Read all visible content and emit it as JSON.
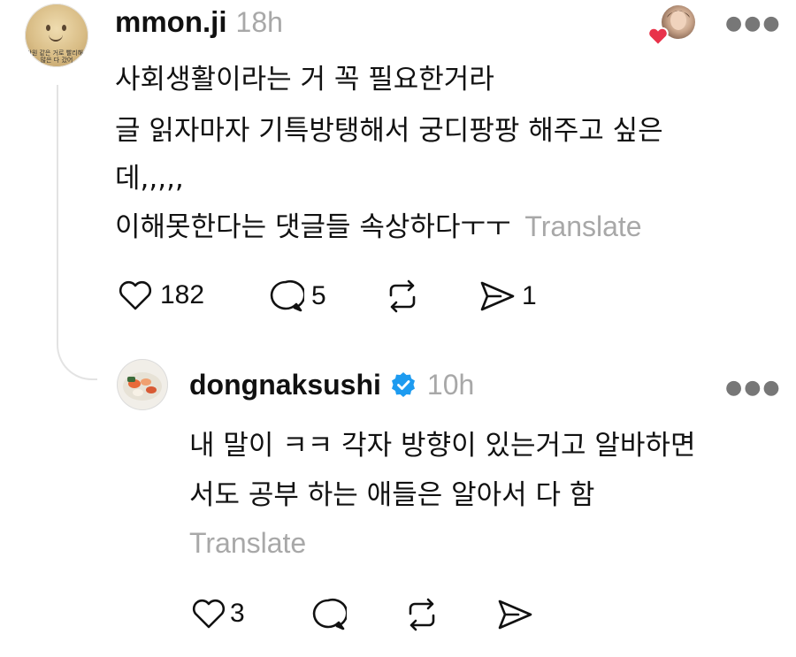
{
  "post": {
    "username": "mmon.ji",
    "time": "18h",
    "avatar_caption": "만원 같은 거로 빨리해 / 많은 다 갔어",
    "lines": [
      "사회생활이라는 거 꼭 필요한거라",
      "글 읽자마자 기특방탱해서 궁디팡팡 해주고 싶은",
      "데,,,,,",
      "이해못한다는 댓글들 속상하다ㅜㅜ"
    ],
    "translate": "Translate",
    "likes": "182",
    "comments": "5",
    "shares": "1"
  },
  "reply": {
    "username": "dongnaksushi",
    "verified": "verified-badge",
    "time": "10h",
    "lines": [
      "내 말이 ㅋㅋ 각자 방향이 있는거고 알바하면",
      "서도 공부 하는 애들은 알아서 다 함"
    ],
    "translate": "Translate",
    "likes": "3"
  },
  "icons": [
    "heart-icon",
    "comment-icon",
    "repost-icon",
    "send-icon",
    "more-icon",
    "verified-badge-icon"
  ],
  "colors": {
    "heart_red": "#e8324a",
    "verified_blue": "#1d9bf0",
    "muted": "#a8a8a8"
  }
}
